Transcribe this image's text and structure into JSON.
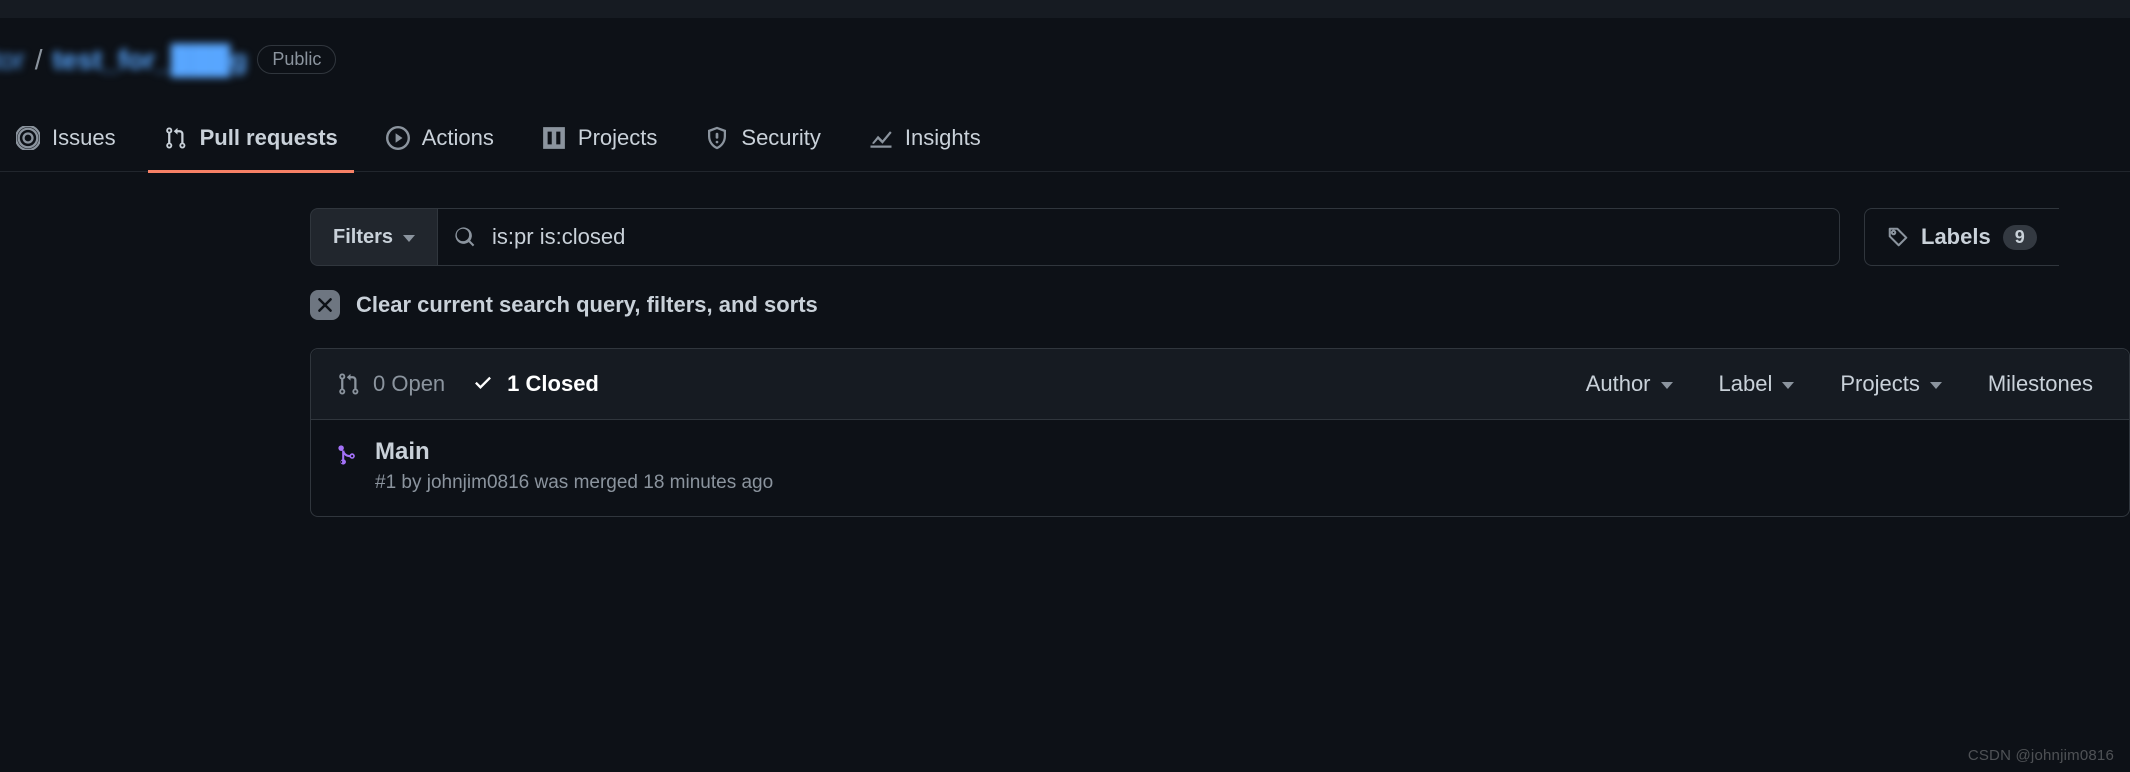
{
  "repo": {
    "owner": "tor",
    "separator": "/",
    "name": "test_for_███g",
    "visibility": "Public"
  },
  "nav": {
    "issues": "Issues",
    "pull_requests": "Pull requests",
    "actions": "Actions",
    "projects": "Projects",
    "security": "Security",
    "insights": "Insights"
  },
  "toolbar": {
    "filters_label": "Filters",
    "search_value": "is:pr is:closed",
    "labels_label": "Labels",
    "labels_count": "9"
  },
  "clear": {
    "label": "Clear current search query, filters, and sorts"
  },
  "state_tabs": {
    "open": "0 Open",
    "closed": "1 Closed"
  },
  "dropdowns": {
    "author": "Author",
    "label": "Label",
    "projects": "Projects",
    "milestones": "Milestones"
  },
  "pr": {
    "title": "Main",
    "meta": "#1 by johnjim0816 was merged 18 minutes ago"
  },
  "watermark": "CSDN @johnjim0816"
}
